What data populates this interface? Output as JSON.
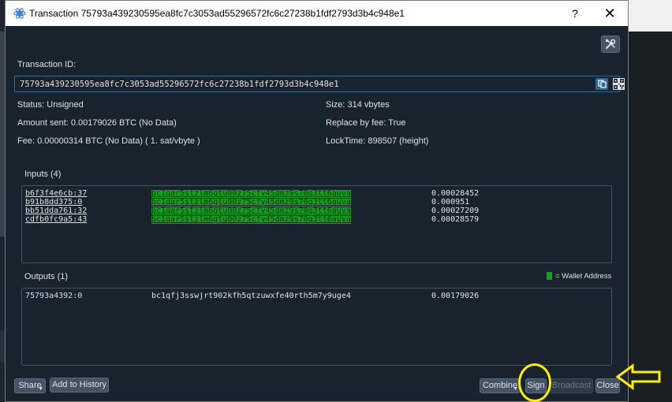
{
  "window": {
    "title": "Transaction 75793a439230595ea8fc7c3053ad55296572fc6c27238b1fdf2793d3b4c948e1",
    "help_glyph": "?",
    "close_glyph": "✕"
  },
  "txid": {
    "label": "Transaction ID:",
    "value": "75793a439230595ea8fc7c3053ad55296572fc6c27238b1fdf2793d3b4c948e1"
  },
  "details": {
    "status": "Status: Unsigned",
    "amount_sent": "Amount sent: 0.00179026 BTC (No Data)",
    "fee": "Fee: 0.00000314 BTC (No Data)  ( 1. sat/vbyte )",
    "size": "Size: 314 vbytes",
    "rbf": "Replace by fee: True",
    "locktime": "LockTime: 898507 (height)"
  },
  "inputs": {
    "header": "Inputs (4)",
    "rows": [
      {
        "outpoint": "b6f3f4e6cb:37",
        "address": "bc1qar5stzlm6gtu00z75cfy45dmz9s70q3tt6auva",
        "amount": "0.00028452"
      },
      {
        "outpoint": "b91b8dd375:0",
        "address": "bc1qar5stzlm6gtu00z75cfy45dmz9s70q3tt6auva",
        "amount": "0.000951"
      },
      {
        "outpoint": "bb51dda761:32",
        "address": "bc1qar5stzlm6gtu00z75cfy45dmz9s70q3tt6auva",
        "amount": "0.00027209"
      },
      {
        "outpoint": "cdfb0fc9a5:43",
        "address": "bc1qar5stzlm6gtu00z75cfy45dmz9s70q3tt6auva",
        "amount": "0.00028579"
      }
    ]
  },
  "outputs": {
    "header": "Outputs (1)",
    "legend": "= Wallet Address",
    "rows": [
      {
        "outpoint": "75793a4392:0",
        "address": "bc1qfj3sswjrt902kfh5qtzuwxfe40rth5m7y9uge4",
        "amount": "0.00179026"
      }
    ]
  },
  "buttons": {
    "share": "Share",
    "add_history": "Add to History",
    "combine": "Combine",
    "sign": "Sign",
    "broadcast": "Broadcast",
    "close": "Close"
  },
  "colors": {
    "background": "#19232d",
    "wallet_highlight": "#16a021",
    "accent": "#346792",
    "annotation": "#ffee00"
  }
}
